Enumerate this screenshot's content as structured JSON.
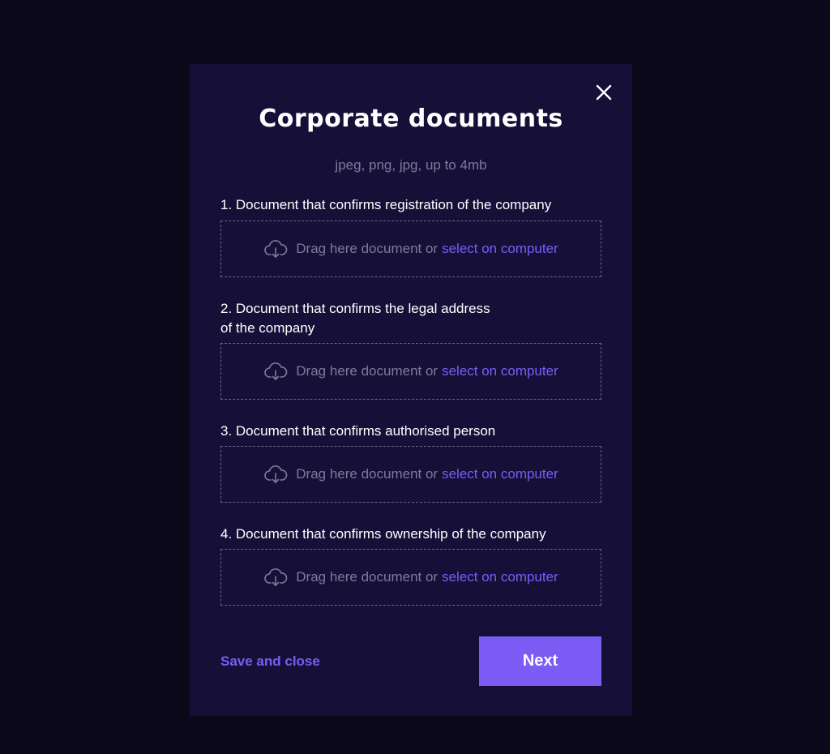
{
  "modal": {
    "title": "Corporate documents",
    "subtitle": "jpeg, png, jpg, up to 4mb",
    "close_icon": "close-icon",
    "documents": [
      {
        "label": "1. Document that confirms registration of the company",
        "drop_text": "Drag here document or",
        "link_text": "select on computer",
        "icon": "cloud-download-icon"
      },
      {
        "label": "2. Document that confirms the legal address\nof the company",
        "drop_text": "Drag here document or",
        "link_text": "select on computer",
        "icon": "cloud-download-icon"
      },
      {
        "label": "3. Document that confirms authorised person",
        "drop_text": "Drag here document or",
        "link_text": "select on computer",
        "icon": "cloud-download-icon"
      },
      {
        "label": "4. Document that confirms ownership of the company",
        "drop_text": "Drag here document or",
        "link_text": "select on computer",
        "icon": "cloud-download-icon"
      }
    ],
    "footer": {
      "save_close_label": "Save and close",
      "next_label": "Next"
    }
  },
  "colors": {
    "page_background": "#0b0819",
    "modal_background": "#161039",
    "accent": "#7b5cf5",
    "muted_text": "#7e7a98",
    "dashed_border": "#6a6687"
  }
}
